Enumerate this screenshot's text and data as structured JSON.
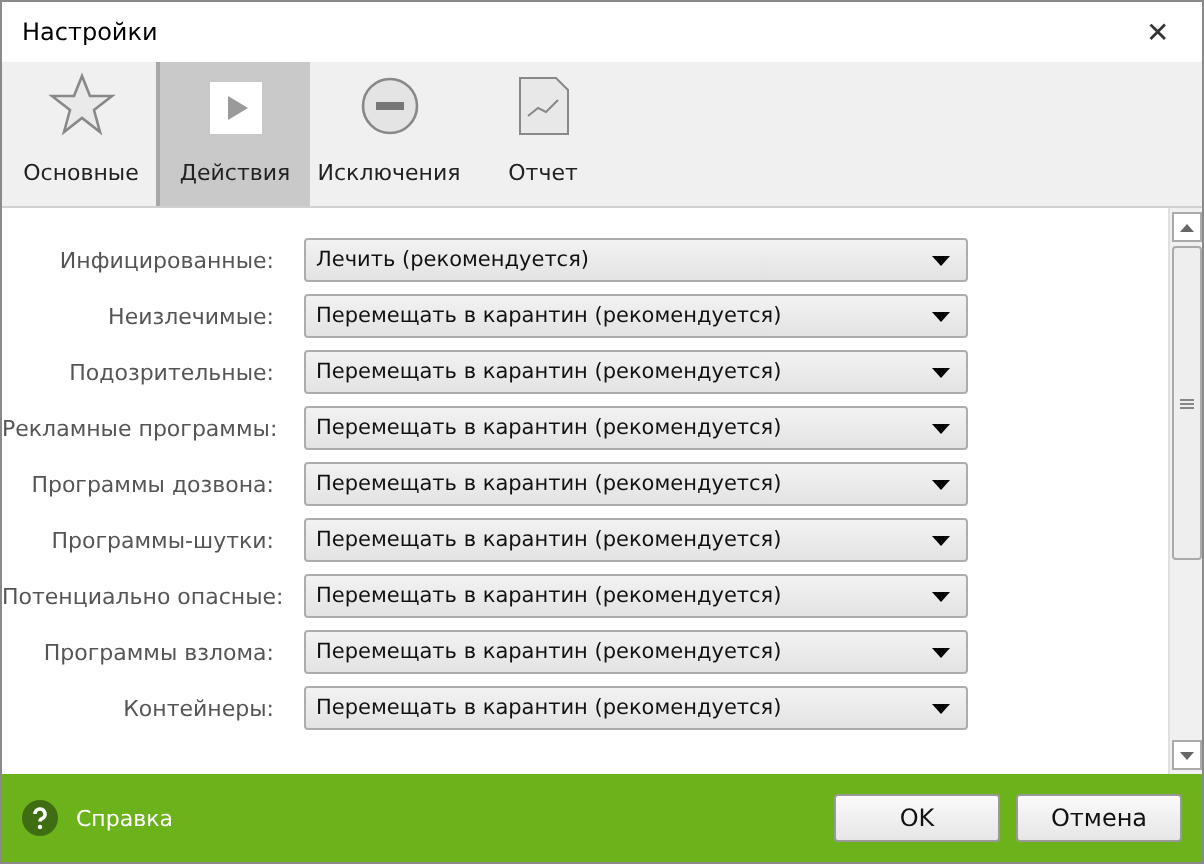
{
  "window": {
    "title": "Настройки",
    "close": "✕"
  },
  "tabs": [
    {
      "label": "Основные",
      "selected": false
    },
    {
      "label": "Действия",
      "selected": true
    },
    {
      "label": "Исключения",
      "selected": false
    },
    {
      "label": "Отчет",
      "selected": false
    }
  ],
  "actions": [
    {
      "label": "Инфицированные:",
      "value": "Лечить (рекомендуется)"
    },
    {
      "label": "Неизлечимые:",
      "value": "Перемещать в карантин (рекомендуется)"
    },
    {
      "label": "Подозрительные:",
      "value": "Перемещать в карантин (рекомендуется)"
    },
    {
      "label": "Рекламные программы:",
      "value": "Перемещать в карантин (рекомендуется)"
    },
    {
      "label": "Программы дозвона:",
      "value": "Перемещать в карантин (рекомендуется)"
    },
    {
      "label": "Программы-шутки:",
      "value": "Перемещать в карантин (рекомендуется)"
    },
    {
      "label": "Потенциально опасные:",
      "value": "Перемещать в карантин (рекомендуется)"
    },
    {
      "label": "Программы взлома:",
      "value": "Перемещать в карантин (рекомендуется)"
    },
    {
      "label": "Контейнеры:",
      "value": "Перемещать в карантин (рекомендуется)"
    }
  ],
  "footer": {
    "help": "Справка",
    "buttons": [
      "OK",
      "Отмена"
    ]
  }
}
